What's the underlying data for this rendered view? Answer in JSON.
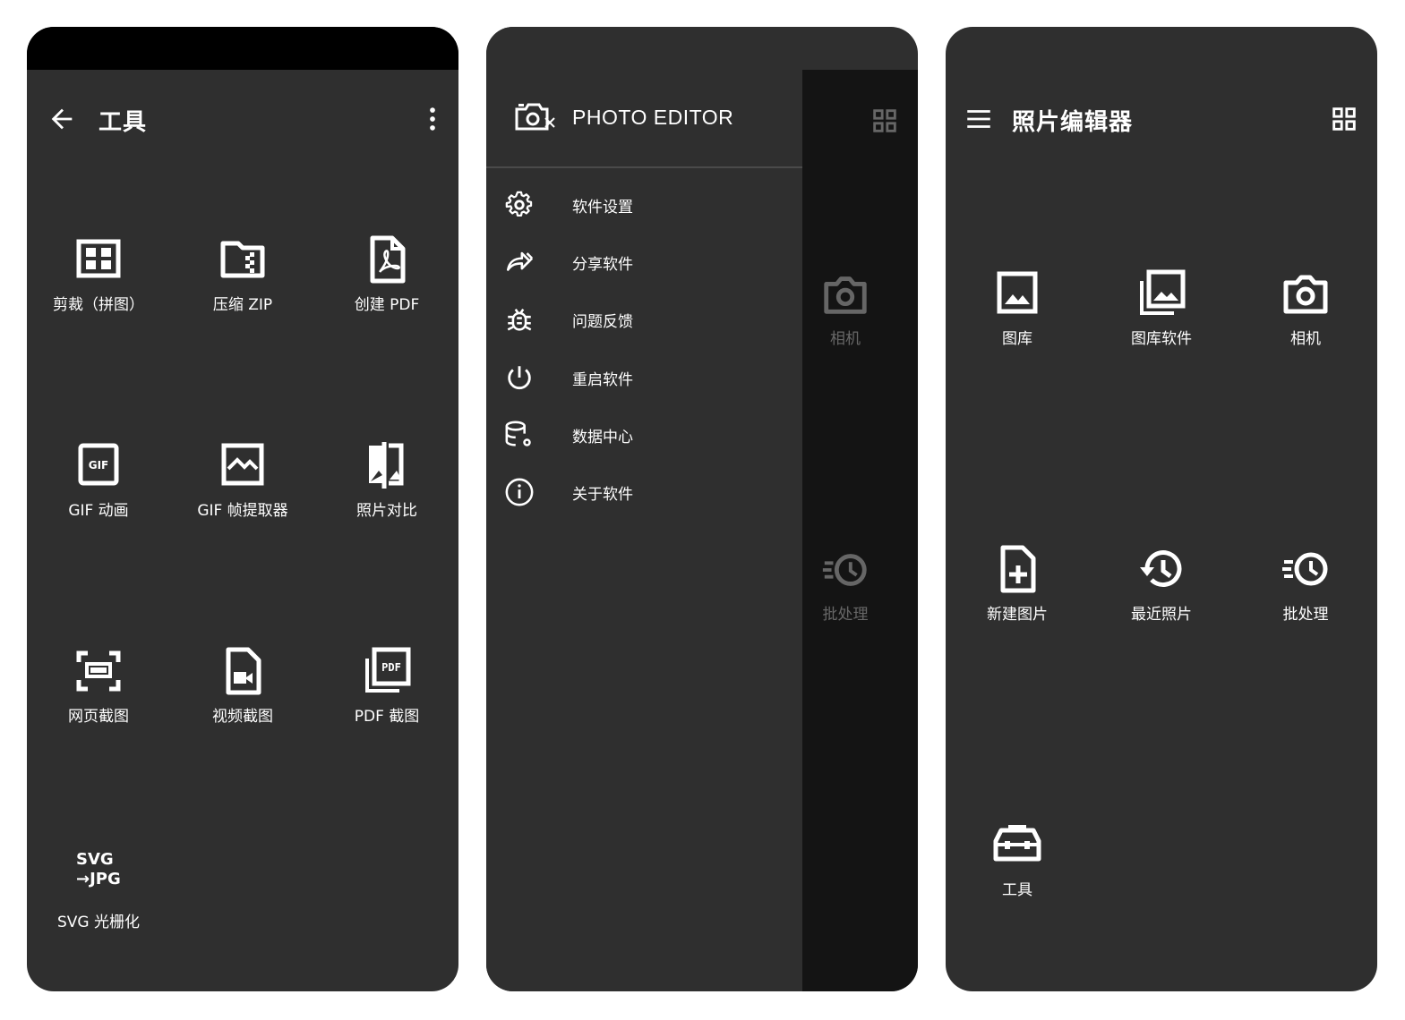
{
  "colors": {
    "panel": "#2f2f2f",
    "status": "#000000",
    "scrim": "#141414",
    "text": "#ffffff"
  },
  "tools_screen": {
    "title": "工具",
    "back_icon": "arrow-left-icon",
    "more_icon": "more-vert-icon",
    "items": [
      {
        "label": "剪裁（拼图）",
        "icon": "collage-grid-icon"
      },
      {
        "label": "压缩 ZIP",
        "icon": "zip-folder-icon"
      },
      {
        "label": "创建 PDF",
        "icon": "pdf-file-icon"
      },
      {
        "label": "GIF 动画",
        "icon": "gif-icon"
      },
      {
        "label": "GIF 帧提取器",
        "icon": "image-frame-icon"
      },
      {
        "label": "照片对比",
        "icon": "compare-icon"
      },
      {
        "label": "网页截图",
        "icon": "screenshot-icon"
      },
      {
        "label": "视频截图",
        "icon": "video-file-icon"
      },
      {
        "label": "PDF 截图",
        "icon": "pdf-stack-icon"
      },
      {
        "label": "SVG 光栅化",
        "icon": "svg-jpg-icon",
        "badge_line1": "SVG",
        "badge_line2": "→JPG"
      }
    ]
  },
  "drawer_screen": {
    "brand": "PHOTO EDITOR",
    "menu": [
      {
        "label": "软件设置",
        "icon": "gear-icon"
      },
      {
        "label": "分享软件",
        "icon": "share-forward-icon"
      },
      {
        "label": "问题反馈",
        "icon": "bug-icon"
      },
      {
        "label": "重启软件",
        "icon": "power-icon"
      },
      {
        "label": "数据中心",
        "icon": "database-settings-icon"
      },
      {
        "label": "关于软件",
        "icon": "info-icon"
      }
    ],
    "behind_items": [
      {
        "label": "相机",
        "icon": "camera-icon"
      },
      {
        "label": "批处理",
        "icon": "batch-clock-icon"
      }
    ]
  },
  "home_screen": {
    "title": "照片编辑器",
    "menu_icon": "hamburger-icon",
    "grid_icon": "grid-view-icon",
    "items": [
      {
        "label": "图库",
        "icon": "gallery-icon"
      },
      {
        "label": "图库软件",
        "icon": "gallery-stack-icon"
      },
      {
        "label": "相机",
        "icon": "camera-icon"
      },
      {
        "label": "新建图片",
        "icon": "new-file-icon"
      },
      {
        "label": "最近照片",
        "icon": "history-icon"
      },
      {
        "label": "批处理",
        "icon": "batch-clock-icon"
      },
      {
        "label": "工具",
        "icon": "toolbox-icon"
      }
    ]
  }
}
